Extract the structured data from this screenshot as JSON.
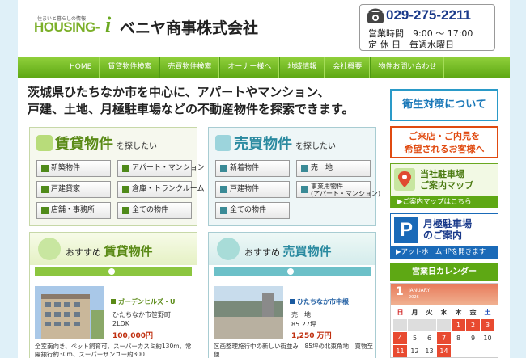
{
  "header": {
    "logo_tagline": "住まいと暮らしの情報",
    "logo_main": "HOUSING-",
    "logo_i": "i",
    "company_name": "ベニヤ商事株式会社",
    "phone": "029-275-2211",
    "hours": "営業時間　9:00 ～ 17:00",
    "holiday": "定 休 日　毎週水曜日"
  },
  "nav": {
    "items": [
      "HOME",
      "賃貸物件検索",
      "売買物件検索",
      "オーナー様へ",
      "地域情報",
      "会社概要",
      "物件お問い合わせ"
    ]
  },
  "intro": {
    "line1": "茨城県ひたちなか市を中心に、アパートやマンション、",
    "line2": "戸建、土地、月極駐車場などの不動産物件を探索できます。"
  },
  "rent_panel": {
    "title": "賃貸物件",
    "sub": "を探したい",
    "buttons": [
      "新築物件",
      "アパート・マンション",
      "戸建貸家",
      "倉庫・トランクルーム",
      "店舗・事務所",
      "全ての物件"
    ]
  },
  "sale_panel": {
    "title": "売買物件",
    "sub": "を探したい",
    "buttons": [
      "新着物件",
      "売　地",
      "戸建物件",
      "事業用物件",
      "(アパート・マンション)",
      "全ての物件"
    ]
  },
  "rec_rent": {
    "prefix": "おすすめ",
    "title": "賃貸物件",
    "name": "ガーデンヒルズ・U",
    "location": "ひたちなか市笹野町",
    "layout": "2LDK",
    "price": "100,000円",
    "desc": "全室南向き、ペット飼育可、スーパーカスミ約130m、常陽銀行約30m、スーパーサンユー約300"
  },
  "rec_sale": {
    "prefix": "おすすめ",
    "title": "売買物件",
    "name": "ひたちなか市中根",
    "type": "売　地",
    "area": "85.27坪",
    "price": "1,250 万円",
    "desc": "区画整理施行中の新しい街並み　85坪の北東角地　買物至便"
  },
  "sidebar": {
    "hygiene": "衛生対策について",
    "visit_line1": "ご来店・ご内見を",
    "visit_line2": "希望されるお客様へ",
    "map_title1": "当社駐車場",
    "map_title2": "ご案内マップ",
    "map_link": "▶ご案内マップはこちら",
    "park_p": "P",
    "park_title1": "月極駐車場",
    "park_title2": "のご案内",
    "park_link": "▶アットホームHPを開きます",
    "calendar_title": "営業日カレンダー"
  },
  "calendar": {
    "num": "1",
    "month": "JANUARY",
    "year": "2026",
    "weekdays": [
      "日",
      "月",
      "火",
      "水",
      "木",
      "金",
      "土"
    ],
    "days": [
      "",
      "",
      "",
      "",
      "1",
      "2",
      "3",
      "4",
      "5",
      "6",
      "7",
      "8",
      "9",
      "10",
      "11",
      "12",
      "13",
      "14"
    ]
  },
  "colors": {
    "nav_green": "#5ea814",
    "brand_green": "#7cb02a",
    "phone_blue": "#1a3a8a",
    "alert_orange": "#e04a10",
    "off_red": "#e84a30"
  }
}
